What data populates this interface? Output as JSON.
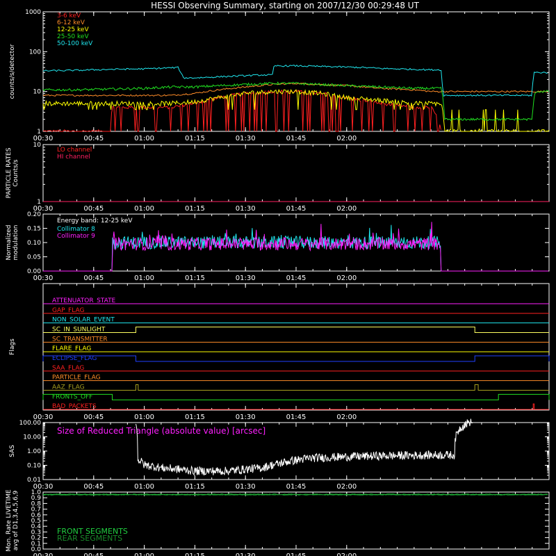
{
  "title": "HESSI Observing Summary, starting on 2007/12/30 00:29:48 UT",
  "time_ticks": [
    "00:30",
    "00:45",
    "01:00",
    "01:15",
    "01:30",
    "01:45",
    "02:00"
  ],
  "colors": {
    "bg": "#000000",
    "axis": "#ffffff",
    "ch_3_6": "#ff2020",
    "ch_6_12": "#ff8c28",
    "ch_12_25": "#ffff00",
    "ch_25_50": "#20e020",
    "ch_50_100": "#20e8f0",
    "collimator8": "#20e8f0",
    "collimator9": "#ff20ff",
    "front": "#20d040",
    "rear": "#1a8a2a"
  },
  "chart_data": [
    {
      "type": "line",
      "panel": "count-rates",
      "ylabel": "counts/s/detector",
      "yscale": "log",
      "ylim": [
        1,
        1000
      ],
      "ytick_labels": [
        "1",
        "10",
        "100",
        "1000"
      ],
      "x_unit": "minutes after 00:30 UT",
      "xlim": [
        0,
        150
      ],
      "series": [
        {
          "name": "3-6 keV",
          "color": "#ff2020",
          "x": [
            0,
            20,
            20.5,
            30,
            38,
            45,
            52,
            60,
            68,
            75,
            82,
            90,
            100,
            110,
            115,
            118
          ],
          "y": [
            1,
            1,
            4,
            4,
            4,
            5,
            7,
            9,
            10,
            10,
            9,
            7,
            5,
            4,
            4,
            1
          ]
        },
        {
          "name": "6-12 keV",
          "color": "#ff8c28",
          "x": [
            0,
            20,
            30,
            38,
            45,
            52,
            60,
            68,
            75,
            82,
            90,
            100,
            110,
            115,
            118,
            150
          ],
          "y": [
            8,
            8,
            8,
            8,
            9,
            11,
            13,
            15,
            16,
            15,
            14,
            12,
            11,
            10,
            10,
            10
          ]
        },
        {
          "name": "12-25 keV",
          "color": "#ffff00",
          "x": [
            0,
            10,
            20,
            30,
            38,
            45,
            52,
            60,
            68,
            75,
            82,
            90,
            100,
            110,
            118,
            119,
            150
          ],
          "y": [
            5,
            5,
            5,
            5,
            5,
            5.5,
            7,
            9,
            10,
            10,
            9,
            7,
            6,
            5,
            5,
            1,
            1
          ]
        },
        {
          "name": "25-50 keV",
          "color": "#20e020",
          "x": [
            0,
            10,
            20,
            30,
            38,
            45,
            52,
            60,
            68,
            75,
            82,
            90,
            100,
            110,
            118,
            119,
            145,
            146,
            150
          ],
          "y": [
            11,
            11,
            11.5,
            12,
            13,
            13,
            14,
            15,
            16,
            16,
            15,
            14,
            13,
            12,
            12,
            2,
            2,
            10,
            10
          ]
        },
        {
          "name": "50-100 keV",
          "color": "#20e8f0",
          "x": [
            0,
            10,
            20,
            30,
            40,
            41.5,
            45,
            50,
            55,
            60,
            65,
            68,
            68.5,
            75,
            85,
            95,
            100,
            110,
            115,
            118,
            118.5,
            132,
            145,
            145.5,
            150
          ],
          "y": [
            33,
            34,
            36,
            37,
            40,
            22,
            22,
            23,
            24,
            25,
            26,
            26,
            44,
            44,
            42,
            40,
            38,
            36,
            35,
            35,
            8,
            8,
            8,
            30,
            30
          ]
        }
      ]
    },
    {
      "type": "line",
      "panel": "particle-rates",
      "ylabel": "PARTICLE RATES Counts/s",
      "yscale": "log",
      "ylim": [
        1,
        10
      ],
      "ytick_labels": [
        "1",
        "10"
      ],
      "xlim": [
        0,
        150
      ],
      "series": [
        {
          "name": "LO channel",
          "color": "#ff2020",
          "x": [
            0,
            150
          ],
          "y": [
            1,
            1
          ]
        },
        {
          "name": "HI channel",
          "color": "#ff2060",
          "x": [
            0,
            150
          ],
          "y": [
            1,
            1
          ]
        }
      ]
    },
    {
      "type": "line",
      "panel": "modulation",
      "ylabel": "Normalized modulation",
      "ylim": [
        0,
        0.2
      ],
      "ytick_labels": [
        "0.00",
        "0.05",
        "0.10",
        "0.15",
        "0.20"
      ],
      "annotation": "Energy band: 12-25 keV",
      "xlim": [
        0,
        150
      ],
      "series": [
        {
          "name": "Collimator 8",
          "color": "#20e8f0",
          "x": [
            0,
            20.5,
            20.6,
            118,
            118.1,
            150
          ],
          "y": [
            0,
            0,
            0.1,
            0.1,
            0,
            0
          ]
        },
        {
          "name": "Collimator 9",
          "color": "#ff20ff",
          "x": [
            0,
            20.5,
            20.6,
            118,
            118.1,
            150
          ],
          "y": [
            0,
            0,
            0.095,
            0.095,
            0,
            0
          ]
        }
      ]
    },
    {
      "type": "line",
      "panel": "flags",
      "ylabel": "Flags",
      "xlim": [
        0,
        150
      ],
      "series": [
        {
          "name": "ATTENUATOR_STATE",
          "color": "#ff20ff",
          "segments": []
        },
        {
          "name": "GAP_FLAG",
          "color": "#ff2020",
          "segments": []
        },
        {
          "name": "NON_SOLAR_EVENT",
          "color": "#20e8f0",
          "segments": []
        },
        {
          "name": "SC_IN_SUNLIGHT",
          "color": "#ffff60",
          "segments": [
            [
              27.5,
              128
            ]
          ]
        },
        {
          "name": "SC_TRANSMITTER",
          "color": "#ff8c28",
          "segments": []
        },
        {
          "name": "FLARE_FLAG",
          "color": "#ffff00",
          "segments": []
        },
        {
          "name": "ECLIPSE_FLAG",
          "color": "#2040ff",
          "segments": [
            [
              0,
              27.5
            ],
            [
              128,
              150
            ]
          ]
        },
        {
          "name": "SAA_FLAG",
          "color": "#ff2020",
          "segments": []
        },
        {
          "name": "PARTICLE_FLAG",
          "color": "#ff8c28",
          "segments": []
        },
        {
          "name": "AAZ_FLAG",
          "color": "#a8a020",
          "segments": [
            [
              27.5,
              28.2
            ],
            [
              128,
              129
            ]
          ]
        },
        {
          "name": "FRONTS_OFF",
          "color": "#20e020",
          "segments": [
            [
              0,
              20.5
            ],
            [
              135,
              150
            ]
          ]
        },
        {
          "name": "BAD_PACKETS",
          "color": "#ff2020",
          "segments": [
            [
              145.3,
              145.6
            ]
          ]
        }
      ]
    },
    {
      "type": "line",
      "panel": "sas",
      "ylabel": "SAS",
      "yscale": "log",
      "ylim": [
        0.01,
        100
      ],
      "ytick_labels": [
        "0.01",
        "0.10",
        "1.00",
        "10.00",
        "100.00"
      ],
      "annotation": "Size of Reduced Triangle (absolute value) [arcsec]",
      "xlim": [
        0,
        150
      ],
      "series": [
        {
          "name": "SAS",
          "color": "#ffffff",
          "x": [
            27.5,
            28,
            30,
            35,
            40,
            45,
            50,
            55,
            60,
            65,
            70,
            80,
            90,
            100,
            110,
            118,
            122,
            127.5
          ],
          "y": [
            80,
            0.2,
            0.08,
            0.05,
            0.04,
            0.03,
            0.03,
            0.03,
            0.04,
            0.05,
            0.1,
            0.25,
            0.3,
            0.35,
            0.38,
            0.4,
            0.4,
            100
          ]
        }
      ]
    },
    {
      "type": "line",
      "panel": "livetime",
      "ylabel": "Mon. Rate LIVETIME avg of D1,3,4,5,6,9",
      "ylim": [
        0,
        1.0
      ],
      "ytick_labels": [
        "0.0",
        "0.1",
        "0.2",
        "0.3",
        "0.4",
        "0.5",
        "0.6",
        "0.7",
        "0.8",
        "0.9",
        "1.0"
      ],
      "xlim": [
        0,
        150
      ],
      "series": [
        {
          "name": "FRONT SEGMENTS",
          "color": "#20d040",
          "x": [
            0,
            150
          ],
          "y": [
            0.96,
            0.96
          ]
        },
        {
          "name": "REAR SEGMENTS",
          "color": "#1a8a2a",
          "x": [
            0,
            150
          ],
          "y": [
            0.95,
            0.95
          ]
        }
      ]
    }
  ]
}
